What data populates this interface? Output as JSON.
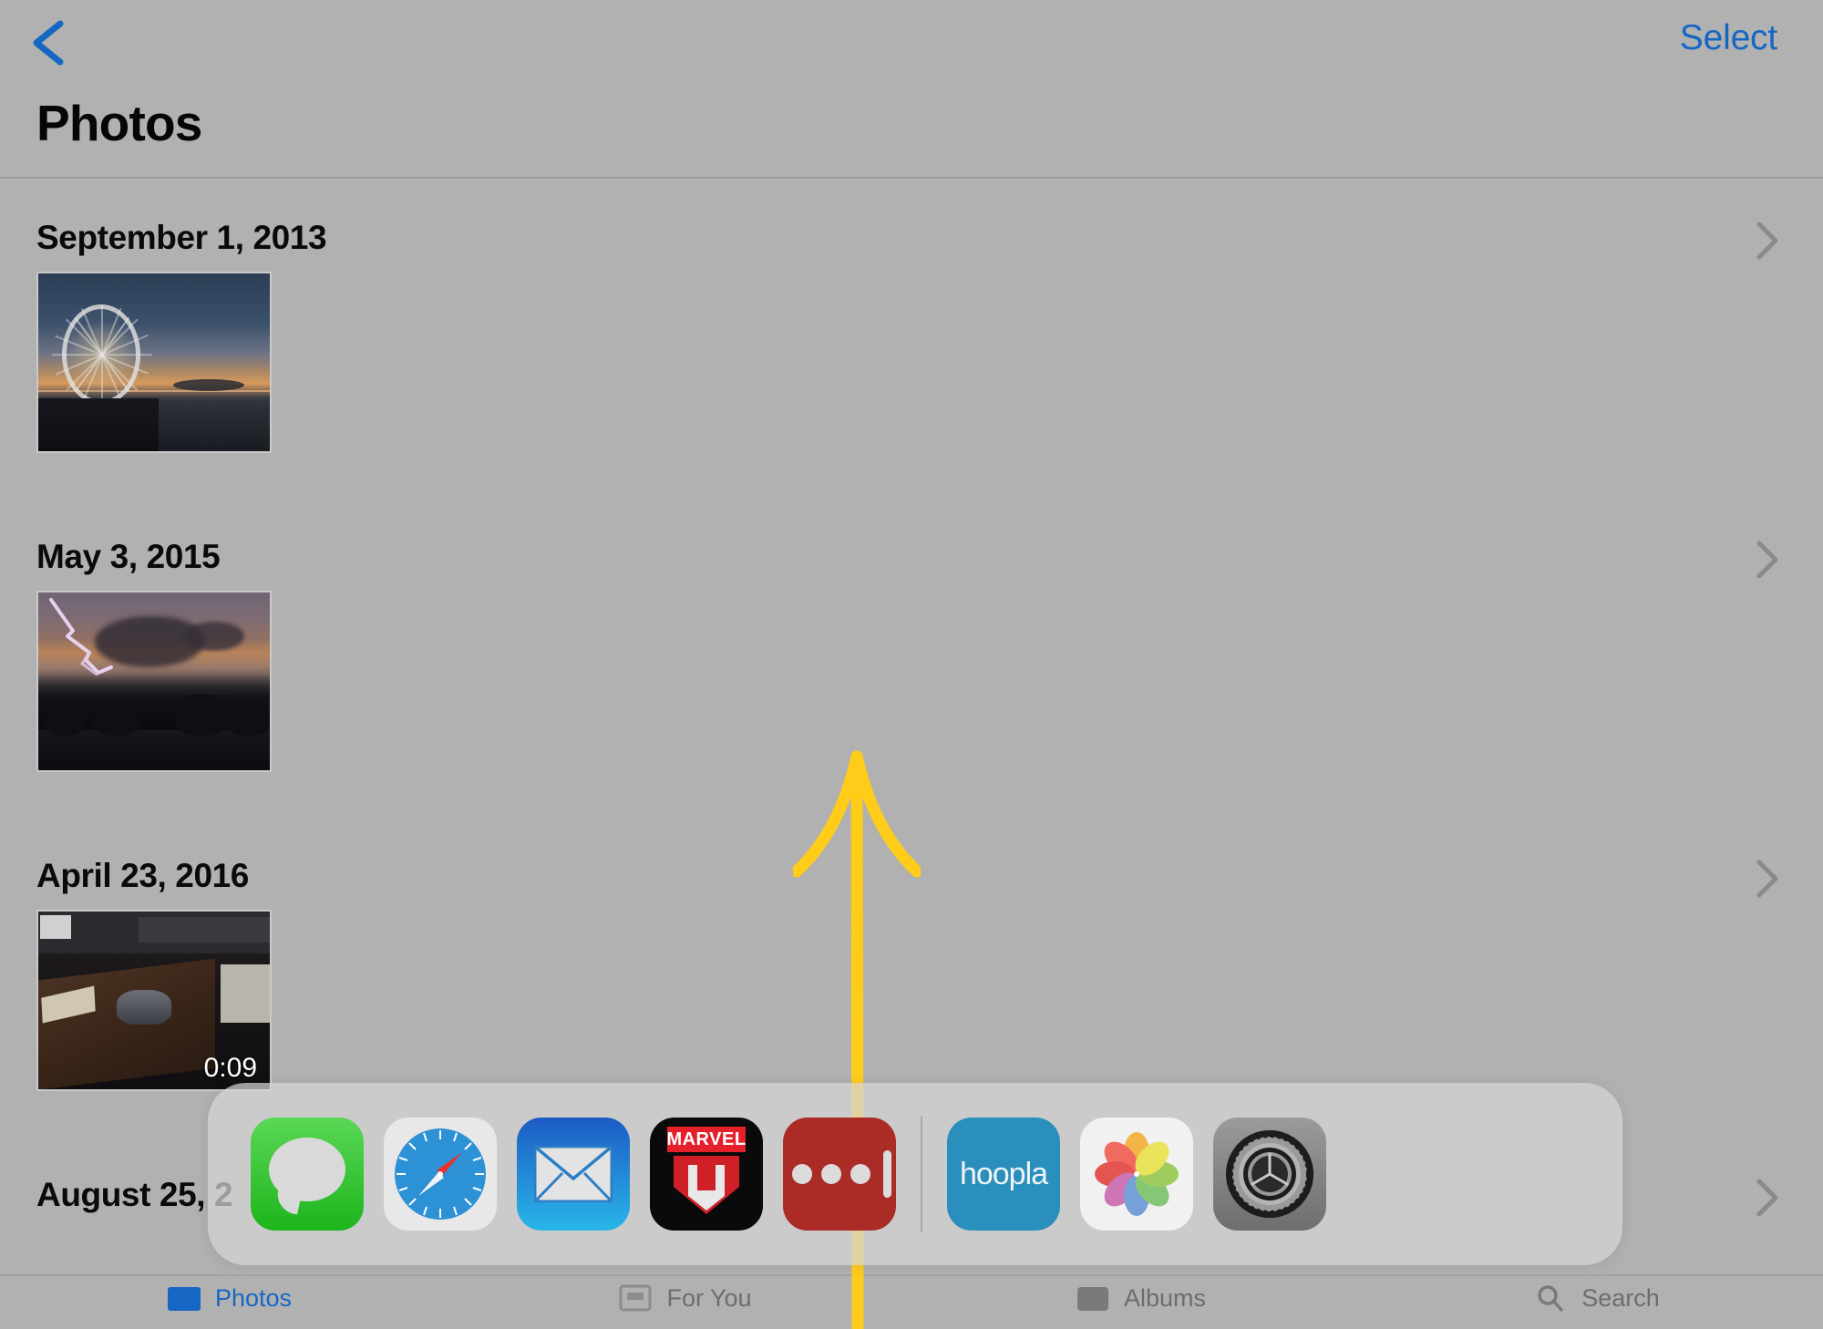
{
  "navbar": {
    "back_icon": "chevron-left-icon",
    "select_label": "Select",
    "title": "Photos",
    "accent_color": "#1667c4"
  },
  "sections": [
    {
      "date": "September 1, 2013",
      "chevron_icon": "chevron-right-icon",
      "photos": [
        {
          "alt": "ferris-wheel-at-sunset-on-pier",
          "style": "ferris",
          "badge": ""
        }
      ]
    },
    {
      "date": "May 3, 2015",
      "chevron_icon": "chevron-right-icon",
      "photos": [
        {
          "alt": "lightning-storm-over-neighborhood",
          "style": "storm",
          "badge": ""
        }
      ]
    },
    {
      "date": "April 23, 2016",
      "chevron_icon": "chevron-right-icon",
      "photos": [
        {
          "alt": "dark-room-wooden-table-video",
          "style": "room",
          "badge": "0:09"
        }
      ]
    },
    {
      "date": "August 25, 2",
      "chevron_icon": "chevron-right-icon",
      "photos": []
    }
  ],
  "dock": {
    "apps": [
      {
        "name": "Messages",
        "icon": "messages-icon"
      },
      {
        "name": "Safari",
        "icon": "safari-icon"
      },
      {
        "name": "Mail",
        "icon": "mail-icon"
      },
      {
        "name": "Marvel Unlimited",
        "icon": "marvel-icon",
        "label": "MARVEL"
      },
      {
        "name": "1Password",
        "icon": "password-dots-icon"
      }
    ],
    "recents": [
      {
        "name": "hoopla",
        "icon": "hoopla-icon",
        "label": "hoopla"
      },
      {
        "name": "Photos",
        "icon": "photos-pinwheel-icon"
      },
      {
        "name": "Settings",
        "icon": "settings-gear-icon"
      }
    ]
  },
  "tabbar": {
    "tabs": [
      {
        "label": "Photos",
        "icon": "photos-tab-icon",
        "active": true
      },
      {
        "label": "For You",
        "icon": "for-you-tab-icon",
        "active": false
      },
      {
        "label": "Albums",
        "icon": "albums-tab-icon",
        "active": false
      },
      {
        "label": "Search",
        "icon": "search-tab-icon",
        "active": false
      }
    ]
  },
  "annotation": {
    "arrow": "yellow-up-arrow",
    "color": "#FFCC1A"
  }
}
